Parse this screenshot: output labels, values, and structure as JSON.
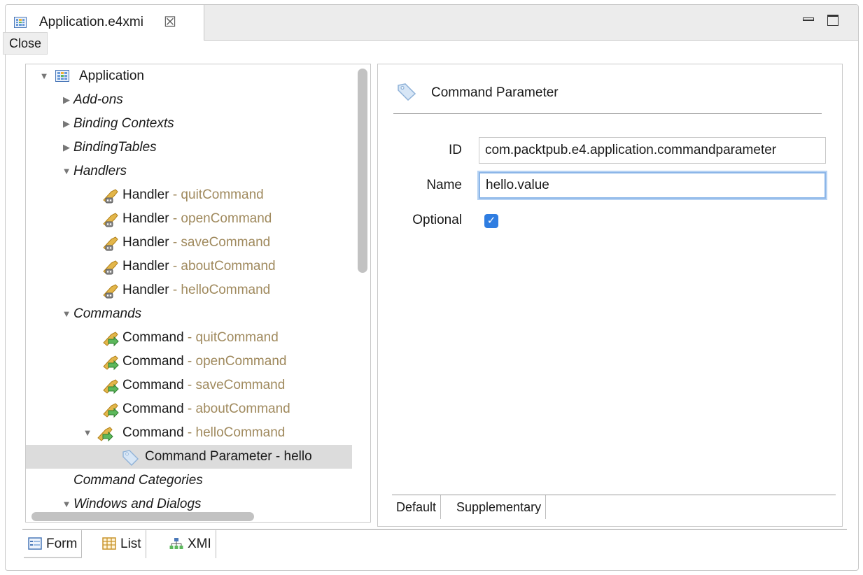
{
  "editor_tab": {
    "title": "Application.e4xmi",
    "close_glyph": "☒",
    "icon": "application-model-icon",
    "tooltip": "Close"
  },
  "window_controls": {
    "minimize_icon": "minimize-icon",
    "maximize_icon": "maximize-icon"
  },
  "tree": {
    "items": [
      {
        "twisty": "▼",
        "icon": "application-icon",
        "label": "Application",
        "suffix": "",
        "italic": false
      },
      {
        "twisty": "▶",
        "label": "Add-ons",
        "italic": true
      },
      {
        "twisty": "▶",
        "label": "Binding Contexts",
        "italic": true
      },
      {
        "twisty": "▶",
        "label": "BindingTables",
        "italic": true
      },
      {
        "twisty": "▼",
        "label": "Handlers",
        "italic": true
      },
      {
        "icon": "handler-icon",
        "label": "Handler",
        "sep": " - ",
        "suffix": "quitCommand"
      },
      {
        "icon": "handler-icon",
        "label": "Handler",
        "sep": " - ",
        "suffix": "openCommand"
      },
      {
        "icon": "handler-icon",
        "label": "Handler",
        "sep": " - ",
        "suffix": "saveCommand"
      },
      {
        "icon": "handler-icon",
        "label": "Handler",
        "sep": " - ",
        "suffix": "aboutCommand"
      },
      {
        "icon": "handler-icon",
        "label": "Handler",
        "sep": " - ",
        "suffix": "helloCommand"
      },
      {
        "twisty": "▼",
        "label": "Commands",
        "italic": true
      },
      {
        "icon": "command-icon",
        "label": "Command",
        "sep": " - ",
        "suffix": "quitCommand"
      },
      {
        "icon": "command-icon",
        "label": "Command",
        "sep": " - ",
        "suffix": "openCommand"
      },
      {
        "icon": "command-icon",
        "label": "Command",
        "sep": " - ",
        "suffix": "saveCommand"
      },
      {
        "icon": "command-icon",
        "label": "Command",
        "sep": " - ",
        "suffix": "aboutCommand"
      },
      {
        "twisty": "▼",
        "icon": "command-icon",
        "label": "Command",
        "sep": " - ",
        "suffix": "helloCommand"
      },
      {
        "icon": "parameter-tag-icon",
        "label": "Command Parameter - hello",
        "selected": true
      },
      {
        "label": "Command Categories",
        "italic": true
      },
      {
        "twisty": "▼",
        "label": "Windows and Dialogs",
        "italic": true
      }
    ]
  },
  "detail": {
    "icon": "parameter-tag-icon",
    "title": "Command Parameter",
    "fields": {
      "id_label": "ID",
      "id_value": "com.packtpub.e4.application.commandparameter",
      "name_label": "Name",
      "name_value": "hello.value",
      "optional_label": "Optional",
      "optional_checked": true,
      "check_glyph": "✓"
    },
    "tabs": [
      "Default",
      "Supplementary"
    ]
  },
  "bottom_tabs": [
    {
      "label": "Form",
      "icon": "form-icon"
    },
    {
      "label": "List",
      "icon": "table-icon"
    },
    {
      "label": "XMI",
      "icon": "tree-hierarchy-icon"
    }
  ]
}
